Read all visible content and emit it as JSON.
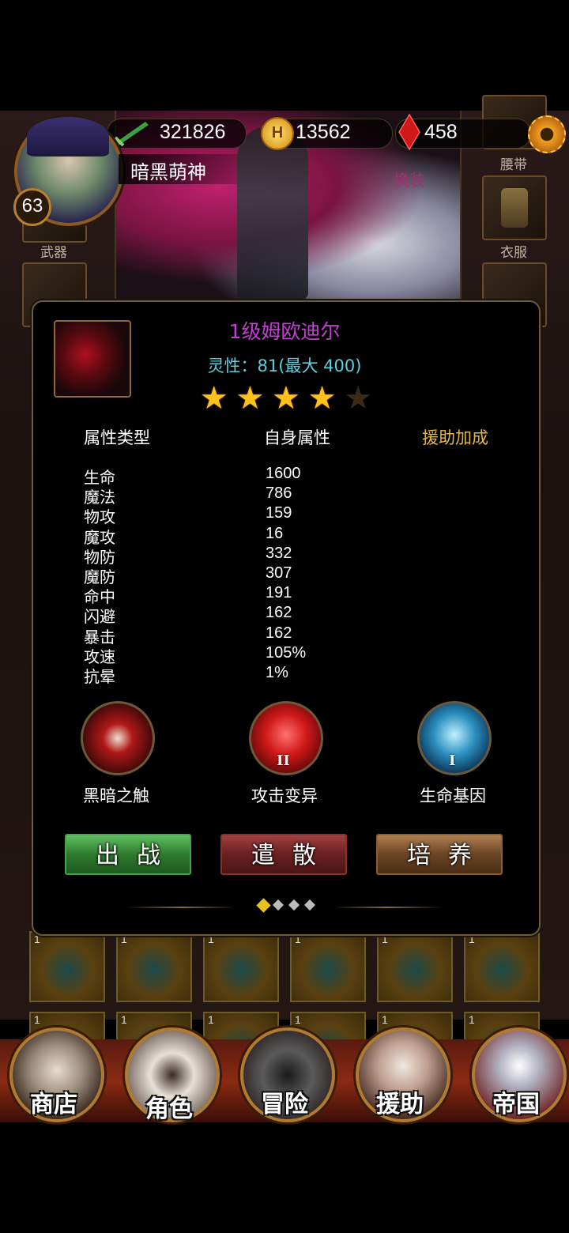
{
  "header": {
    "level": "63",
    "player_name": "暗黑萌神",
    "power": "321826",
    "gold": "13562",
    "gems": "458",
    "change_outfit": "换装"
  },
  "equipment_slots": {
    "belt": "腰带",
    "weapon": "武器",
    "clothes": "衣服"
  },
  "pet_dialog": {
    "title": "1级姆欧迪尔",
    "spirit": "灵性：81(最大 400)",
    "stars_filled": 4,
    "stars_total": 5,
    "columns": {
      "type": "属性类型",
      "self": "自身属性",
      "assist": "援助加成"
    },
    "stats": [
      {
        "name": "生命",
        "value": "1600"
      },
      {
        "name": "魔法",
        "value": "786"
      },
      {
        "name": "物攻",
        "value": "159"
      },
      {
        "name": "魔攻",
        "value": "16"
      },
      {
        "name": "物防",
        "value": "332"
      },
      {
        "name": "魔防",
        "value": "307"
      },
      {
        "name": "命中",
        "value": "191"
      },
      {
        "name": "闪避",
        "value": "162"
      },
      {
        "name": "暴击",
        "value": "162"
      },
      {
        "name": "攻速",
        "value": "105%"
      },
      {
        "name": "抗晕",
        "value": "1%"
      }
    ],
    "skills": [
      {
        "name": "黑暗之触",
        "roman": ""
      },
      {
        "name": "攻击变异",
        "roman": "II"
      },
      {
        "name": "生命基因",
        "roman": "I"
      }
    ],
    "buttons": {
      "deploy": "出战",
      "dismiss": "遣散",
      "train": "培养"
    },
    "pager": {
      "current": 1,
      "total": 4
    }
  },
  "inventory": {
    "cell_number": "1"
  },
  "nav": {
    "shop": "商店",
    "character": "角色",
    "adventure": "冒险",
    "assist": "援助",
    "empire": "帝国"
  },
  "colors": {
    "title": "#c040d0",
    "spirit": "#5ad0e0",
    "assist_header": "#e8b840",
    "star": "#ffc21a"
  }
}
